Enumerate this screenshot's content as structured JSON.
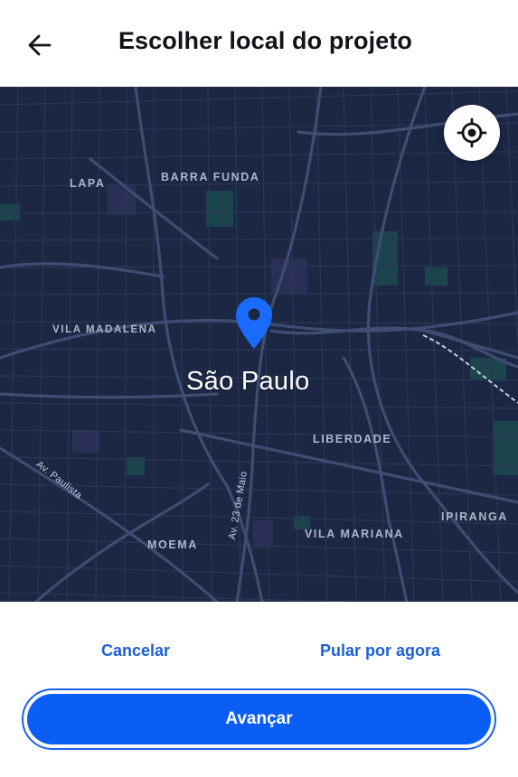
{
  "header": {
    "title": "Escolher local do projeto",
    "back_icon": "arrow-left-icon"
  },
  "map": {
    "city": "São Paulo",
    "districts": [
      "LAPA",
      "BARRA FUNDA",
      "VILA MADALENA",
      "LIBERDADE",
      "IPIRANGA",
      "VILA MARIANA",
      "MOEMA"
    ],
    "streets": [
      "Av. Paulista",
      "Av. 23 de Maio"
    ],
    "locate_icon": "gps-crosshair-icon",
    "pin_icon": "map-pin-icon",
    "colors": {
      "background": "#1c2744",
      "pin": "#1a6bff"
    }
  },
  "footer": {
    "cancel_label": "Cancelar",
    "skip_label": "Pular por agora",
    "next_label": "Avançar"
  },
  "colors": {
    "accent": "#0a5df5",
    "link": "#1c5fd6"
  }
}
